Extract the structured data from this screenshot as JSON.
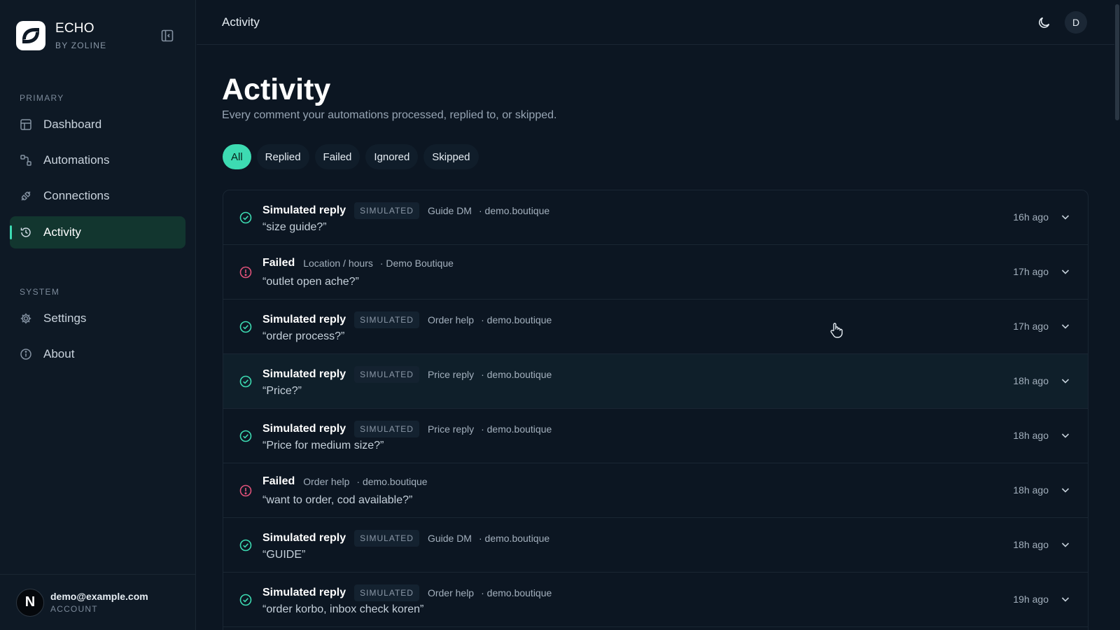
{
  "brand": {
    "name": "ECHO",
    "sub": "BY ZOLINE"
  },
  "sidebar": {
    "primary_label": "PRIMARY",
    "system_label": "SYSTEM",
    "primary_items": [
      {
        "label": "Dashboard",
        "icon": "layout-icon"
      },
      {
        "label": "Automations",
        "icon": "workflow-icon"
      },
      {
        "label": "Connections",
        "icon": "plug-icon"
      },
      {
        "label": "Activity",
        "icon": "history-icon",
        "active": true
      }
    ],
    "system_items": [
      {
        "label": "Settings",
        "icon": "gear-icon"
      },
      {
        "label": "About",
        "icon": "info-icon"
      }
    ]
  },
  "account": {
    "initial": "N",
    "email": "demo@example.com",
    "label": "ACCOUNT"
  },
  "topbar": {
    "title": "Activity",
    "user_initial": "D"
  },
  "page": {
    "title": "Activity",
    "subtitle": "Every comment your automations processed, replied to, or skipped."
  },
  "filters": [
    "All",
    "Replied",
    "Failed",
    "Ignored",
    "Skipped"
  ],
  "active_filter": "All",
  "colors": {
    "accent": "#3ddbb2",
    "success": "#3ddbb2",
    "error": "#e0527a"
  },
  "rows": [
    {
      "status": "success",
      "title": "Simulated reply",
      "badge": "SIMULATED",
      "automation": "Guide DM",
      "account": "· demo.boutique",
      "quote": "“size guide?”",
      "time": "16h ago"
    },
    {
      "status": "error",
      "title": "Failed",
      "badge": "",
      "automation": "Location / hours",
      "account": "· Demo Boutique",
      "quote": "“outlet open ache?”",
      "time": "17h ago"
    },
    {
      "status": "success",
      "title": "Simulated reply",
      "badge": "SIMULATED",
      "automation": "Order help",
      "account": "· demo.boutique",
      "quote": "“order process?”",
      "time": "17h ago"
    },
    {
      "status": "success",
      "title": "Simulated reply",
      "badge": "SIMULATED",
      "automation": "Price reply",
      "account": "· demo.boutique",
      "quote": "“Price?”",
      "time": "18h ago"
    },
    {
      "status": "success",
      "title": "Simulated reply",
      "badge": "SIMULATED",
      "automation": "Price reply",
      "account": "· demo.boutique",
      "quote": "“Price for medium size?”",
      "time": "18h ago"
    },
    {
      "status": "error",
      "title": "Failed",
      "badge": "",
      "automation": "Order help",
      "account": "· demo.boutique",
      "quote": "“want to order, cod available?”",
      "time": "18h ago"
    },
    {
      "status": "success",
      "title": "Simulated reply",
      "badge": "SIMULATED",
      "automation": "Guide DM",
      "account": "· demo.boutique",
      "quote": "“GUIDE”",
      "time": "18h ago"
    },
    {
      "status": "success",
      "title": "Simulated reply",
      "badge": "SIMULATED",
      "automation": "Order help",
      "account": "· demo.boutique",
      "quote": "“order korbo, inbox check koren”",
      "time": "19h ago"
    }
  ]
}
